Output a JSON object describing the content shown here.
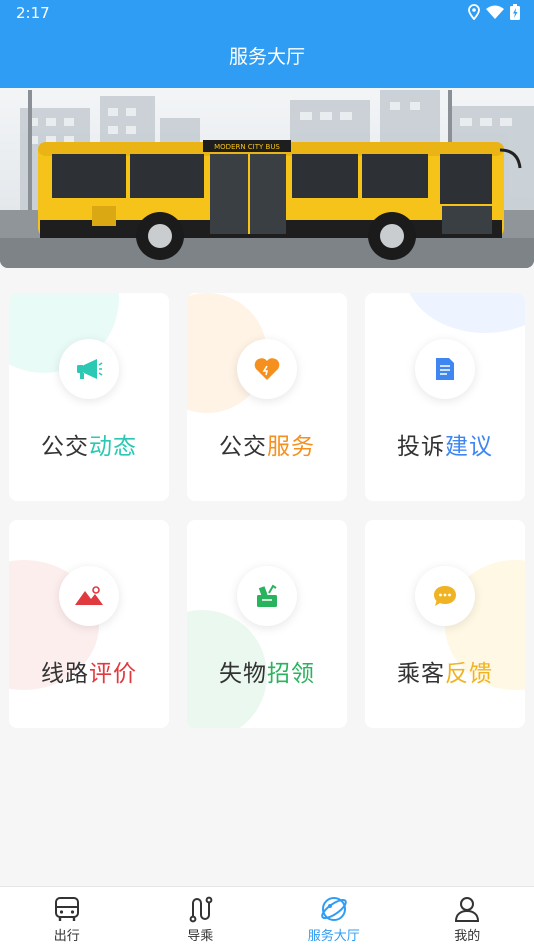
{
  "status_bar": {
    "time": "2:17",
    "icons": [
      "location-icon",
      "wifi-icon",
      "battery-icon"
    ]
  },
  "app_bar": {
    "title": "服务大厅"
  },
  "banner": {
    "bus_sign": "MODERN CITY BUS"
  },
  "services": [
    {
      "prefix": "公交",
      "accent": "动态",
      "accent_color": "#2bc8b4",
      "icon": "megaphone-icon"
    },
    {
      "prefix": "公交",
      "accent": "服务",
      "accent_color": "#f5901e",
      "icon": "heart-icon"
    },
    {
      "prefix": "投诉",
      "accent": "建议",
      "accent_color": "#3f86f0",
      "icon": "document-icon"
    },
    {
      "prefix": "线路",
      "accent": "评价",
      "accent_color": "#e0393e",
      "icon": "mountain-icon"
    },
    {
      "prefix": "失物",
      "accent": "招领",
      "accent_color": "#29b35d",
      "icon": "lost-found-icon"
    },
    {
      "prefix": "乘客",
      "accent": "反馈",
      "accent_color": "#f0b323",
      "icon": "chat-icon"
    }
  ],
  "tabs": [
    {
      "label": "出行",
      "icon": "bus-icon",
      "active": false
    },
    {
      "label": "导乘",
      "icon": "route-icon",
      "active": false
    },
    {
      "label": "服务大厅",
      "icon": "service-hall-icon",
      "active": true
    },
    {
      "label": "我的",
      "icon": "profile-icon",
      "active": false
    }
  ],
  "colors": {
    "primary": "#2f9df4",
    "background": "#f6f6f6"
  }
}
